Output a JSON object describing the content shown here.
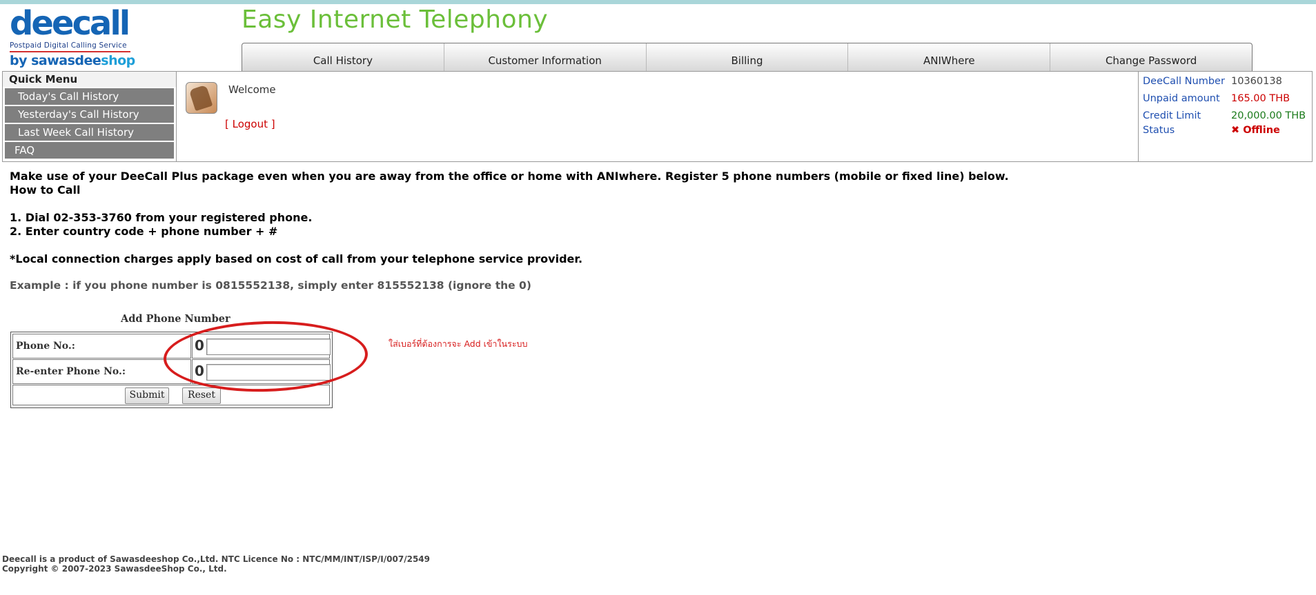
{
  "logo": {
    "brand": "deecall",
    "subtitle": "Postpaid Digital Calling Service",
    "byline_prefix": "by sawasdee",
    "byline_suffix": "shop"
  },
  "header": {
    "tagline": "Easy Internet Telephony"
  },
  "nav": {
    "tabs": [
      {
        "label": "Call History"
      },
      {
        "label": "Customer Information"
      },
      {
        "label": "Billing"
      },
      {
        "label": "ANIWhere"
      },
      {
        "label": "Change Password"
      }
    ]
  },
  "quick_menu": {
    "title": "Quick Menu",
    "items": [
      {
        "label": "Today's Call History"
      },
      {
        "label": "Yesterday's Call History"
      },
      {
        "label": "Last Week Call History"
      },
      {
        "label": "FAQ"
      }
    ]
  },
  "user": {
    "welcome": "Welcome",
    "logout": "[ Logout ]"
  },
  "account": {
    "number_label": "DeeCall Number",
    "number_value": "10360138",
    "unpaid_label": "Unpaid amount",
    "unpaid_value": "165.00 THB",
    "credit_label": "Credit Limit",
    "credit_value": "20,000.00 THB",
    "status_label": "Status",
    "status_value": "Offline",
    "status_icon": "x-icon"
  },
  "intro": {
    "line1": "Make use of your DeeCall Plus package even when you are away from the office or home with ANIwhere. Register 5 phone numbers (mobile or fixed line) below.",
    "line2": "How to Call",
    "step1": "1. Dial 02-353-3760 from your registered phone.",
    "step2": "2. Enter country code + phone number + #",
    "note": "*Local connection charges apply based on cost of call from your telephone service provider.",
    "example": "Example : if you phone number is 0815552138, simply enter 815552138 (ignore the 0)"
  },
  "form": {
    "title": "Add Phone Number",
    "phone_label": "Phone No.:",
    "reenter_label": "Re-enter Phone No.:",
    "prefix": "0",
    "phone_value": "",
    "reenter_value": "",
    "submit": "Submit",
    "reset": "Reset"
  },
  "annotation": {
    "text": "ใส่เบอร์ที่ต้องการจะ Add เข้าในระบบ",
    "color": "#d71d1d"
  },
  "footer": {
    "line1": "Deecall is a product of Sawasdeeshop Co.,Ltd. NTC Licence No : NTC/MM/INT/ISP/I/007/2549",
    "line2": "Copyright © 2007-2023 SawasdeeShop Co., Ltd."
  }
}
